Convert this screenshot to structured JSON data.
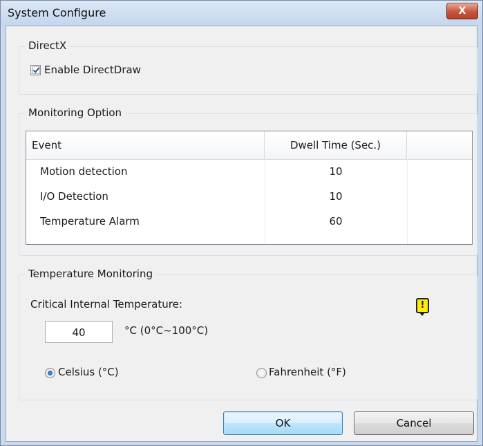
{
  "window": {
    "title": "System Configure",
    "close_label": "X"
  },
  "directx": {
    "group_title": "DirectX",
    "enable_directdraw_label": "Enable DirectDraw",
    "enable_directdraw_checked": true
  },
  "monitoring": {
    "group_title": "Monitoring Option",
    "columns": [
      "Event",
      "Dwell Time (Sec.)"
    ],
    "rows": [
      {
        "event": "Motion detection",
        "dwell": "10"
      },
      {
        "event": "I/O Detection",
        "dwell": "10"
      },
      {
        "event": "Temperature Alarm",
        "dwell": "60"
      }
    ]
  },
  "temperature": {
    "group_title": "Temperature Monitoring",
    "critical_label": "Critical Internal Temperature:",
    "value": "40",
    "range_label": "°C  (0°C~100°C)",
    "celsius_label": "Celsius (°C)",
    "fahrenheit_label": "Fahrenheit (°F)",
    "selected_unit": "celsius",
    "warning_icon": "warning-icon"
  },
  "buttons": {
    "ok": "OK",
    "cancel": "Cancel"
  }
}
